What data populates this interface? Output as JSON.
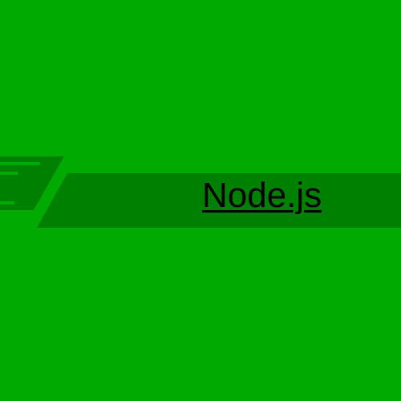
{
  "colors": {
    "background": "#00aa00",
    "banner": "#008000",
    "speed_lines": "#00aa00",
    "link_text": "#000000"
  },
  "banner": {
    "link_label": "Node.js"
  },
  "decor": {
    "icon": "speed-lines-icon"
  }
}
